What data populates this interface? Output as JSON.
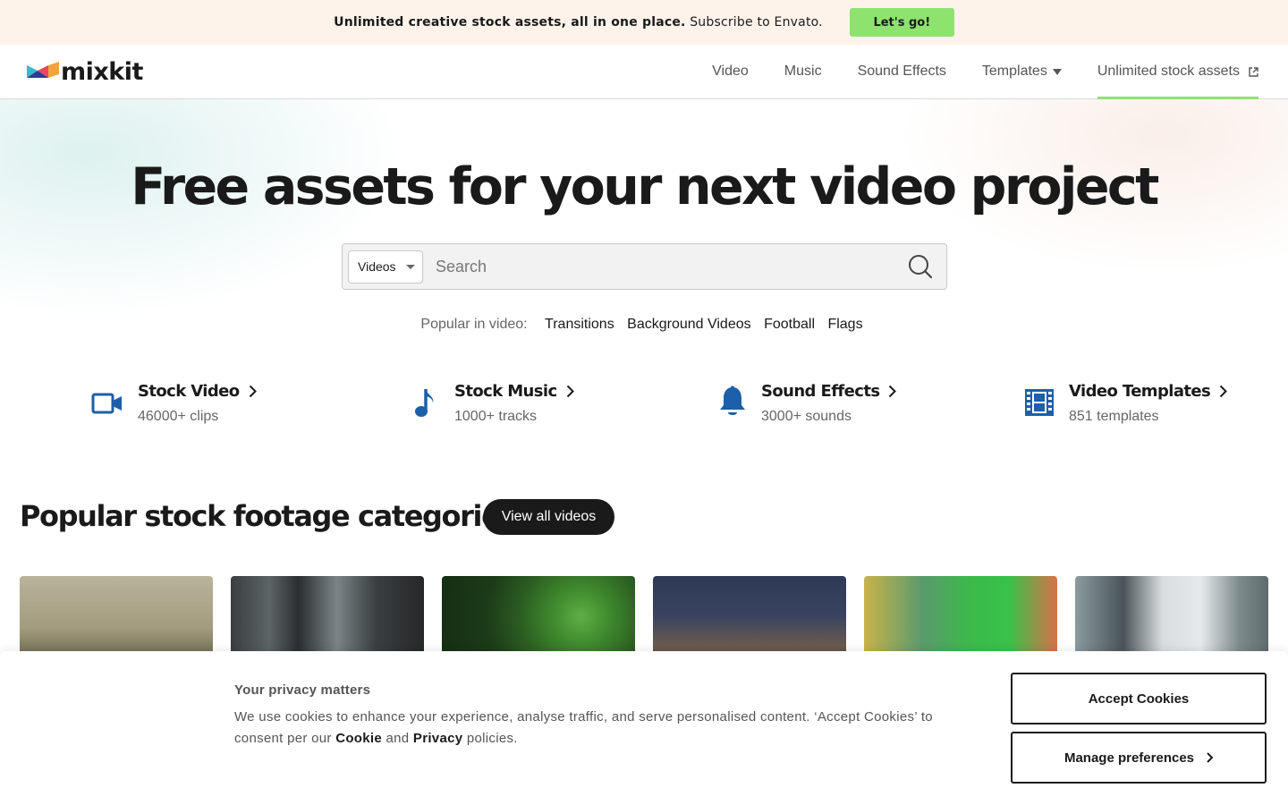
{
  "promo": {
    "bold_text": "Unlimited creative stock assets, all in one place.",
    "text": "Subscribe to Envato.",
    "button": "Let's go!"
  },
  "header": {
    "logo": "mixkit",
    "nav": [
      {
        "label": "Video"
      },
      {
        "label": "Music"
      },
      {
        "label": "Sound Effects"
      },
      {
        "label": "Templates"
      },
      {
        "label": "Unlimited stock assets"
      }
    ]
  },
  "hero": {
    "title": "Free assets for your next video project",
    "search": {
      "type_selected": "Videos",
      "placeholder": "Search"
    },
    "popular_label": "Popular in video:",
    "popular_tags": [
      "Transitions",
      "Background Videos",
      "Football",
      "Flags"
    ]
  },
  "categories": [
    {
      "title": "Stock Video",
      "subtitle": "46000+ clips",
      "icon": "video-camera-icon"
    },
    {
      "title": "Stock Music",
      "subtitle": "1000+ tracks",
      "icon": "music-note-icon"
    },
    {
      "title": "Sound Effects",
      "subtitle": "3000+ sounds",
      "icon": "bell-icon"
    },
    {
      "title": "Video Templates",
      "subtitle": "851 templates",
      "icon": "film-strip-icon"
    }
  ],
  "footage": {
    "title": "Popular stock footage categories",
    "view_all": "View all videos"
  },
  "cookie": {
    "title": "Your privacy matters",
    "text_1": "We use cookies to enhance your experience, analyse traffic, and serve personalised content. ‘Accept Cookies’ to consent per our",
    "cookie_link": "Cookie",
    "and": "and",
    "privacy_link": "Privacy",
    "text_2": "policies.",
    "accept": "Accept Cookies",
    "manage": "Manage preferences"
  },
  "colors": {
    "accent_green": "#8ee36f",
    "icon_blue": "#1d5fa8",
    "promo_bg": "#fdf3ea"
  }
}
